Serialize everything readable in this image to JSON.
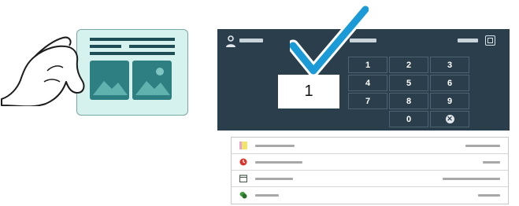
{
  "panel": {
    "quantity_value": "1",
    "keypad": {
      "keys": [
        "1",
        "2",
        "3",
        "4",
        "5",
        "6",
        "7",
        "8",
        "9",
        "0"
      ],
      "cancel_symbol": "✕"
    }
  },
  "icons": {
    "user": "user-icon",
    "clear": "clear-icon",
    "checkmark": "checkmark-icon",
    "hand": "hand-icon",
    "cancel": "cancel-icon"
  },
  "colors": {
    "panel_bg": "#2a3e4c",
    "check_blue": "#1a9bd7",
    "card_bg": "#d6f2ef",
    "photo_teal": "#2d7f82",
    "row_icon_yellow": "#f0e66a",
    "row_icon_red": "#d9322b",
    "row_icon_gray": "#4d5d52",
    "row_icon_green": "#3e9a3c"
  },
  "list": {
    "rows": [
      {
        "icon": "note-icon"
      },
      {
        "icon": "clock-icon"
      },
      {
        "icon": "calendar-icon"
      },
      {
        "icon": "leaf-icon"
      }
    ]
  }
}
